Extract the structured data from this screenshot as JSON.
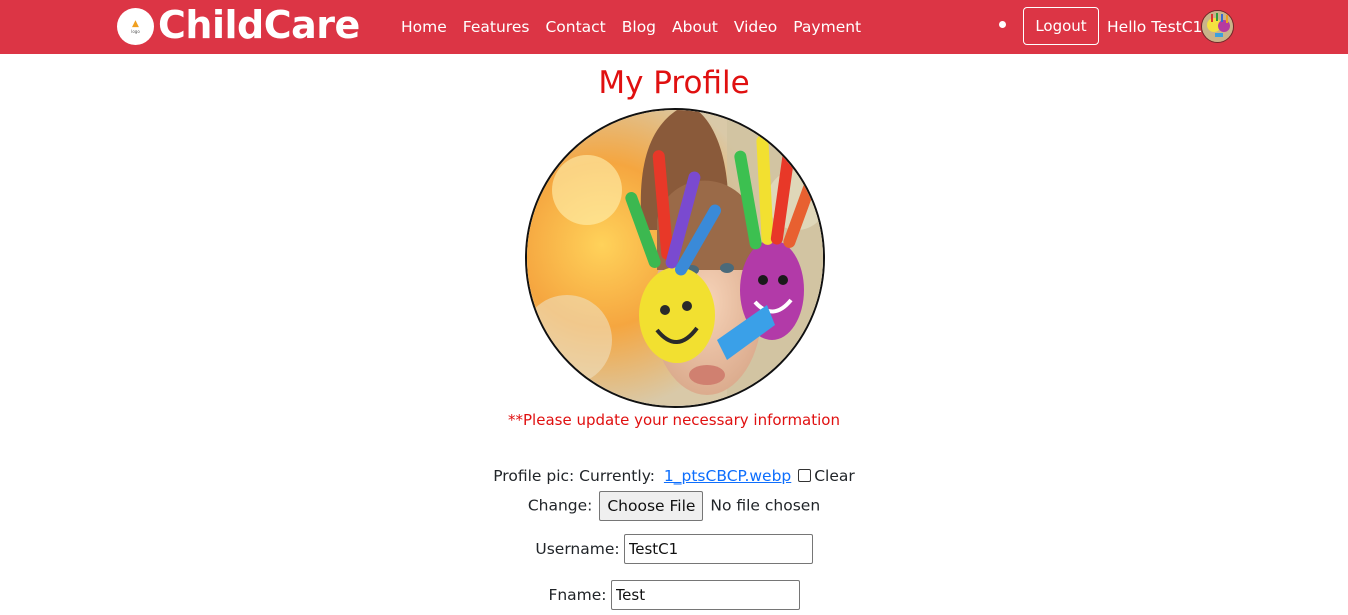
{
  "brand": {
    "name": "ChildCare",
    "logo_icon": "childcare-logo-icon",
    "logo_text": "logo"
  },
  "nav": {
    "links": [
      "Home",
      "Features",
      "Contact",
      "Blog",
      "About",
      "Video",
      "Payment"
    ],
    "logout_label": "Logout",
    "greeting": "Hello TestC1"
  },
  "page": {
    "title": "My Profile",
    "note": "**Please update your necessary information"
  },
  "form": {
    "profile_pic_label": "Profile pic: Currently:",
    "current_file": "1_ptsCBCP.webp",
    "clear_label": "Clear",
    "change_label": "Change:",
    "choose_file_label": "Choose File",
    "no_file_text": "No file chosen",
    "username_label": "Username:",
    "username_value": "TestC1",
    "fname_label": "Fname:",
    "fname_value": "Test"
  },
  "colors": {
    "navbar": "#dc3545",
    "title": "#e01010",
    "link": "#0d6efd"
  }
}
